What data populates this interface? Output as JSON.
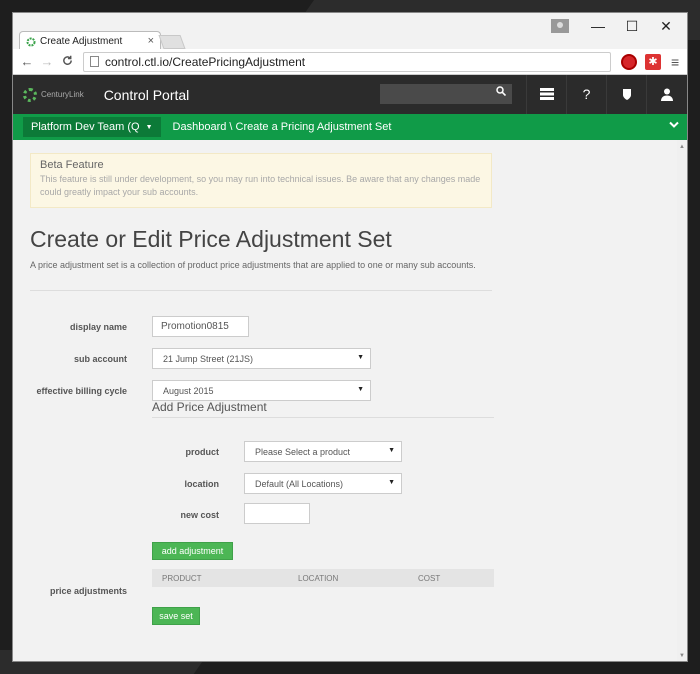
{
  "browser": {
    "tab_title": "Create Adjustment",
    "tab_close": "×",
    "url": "control.ctl.io/CreatePricingAdjustment",
    "window_controls": [
      "—",
      "☐",
      "✕"
    ],
    "nav": {
      "back": "←",
      "forward": "→",
      "reload": "C"
    },
    "menu": "≡"
  },
  "portal": {
    "logo_text": "CenturyLink",
    "title": "Control Portal",
    "search_placeholder": "",
    "header_icons": [
      "queue-icon",
      "help-icon",
      "shield-icon",
      "user-icon"
    ]
  },
  "greenbar": {
    "account": "Platform Dev Team (Q",
    "breadcrumb": "Dashboard \\ Create a Pricing Adjustment Set"
  },
  "beta": {
    "title": "Beta Feature",
    "text": "This feature is still under development, so you may run into technical issues. Be aware that any changes made could greatly impact your sub accounts."
  },
  "page": {
    "title": "Create or Edit Price Adjustment Set",
    "description": "A price adjustment set is a collection of product price adjustments that are applied to one or many sub accounts."
  },
  "form": {
    "display_name_label": "display name",
    "display_name_value": "Promotion0815",
    "sub_account_label": "sub account",
    "sub_account_value": "21 Jump Street (21JS)",
    "billing_cycle_label": "effective billing cycle",
    "billing_cycle_value": "August 2015"
  },
  "add_adjustment": {
    "title": "Add Price Adjustment",
    "product_label": "product",
    "product_value": "Please Select a product",
    "location_label": "location",
    "location_value": "Default (All Locations)",
    "new_cost_label": "new cost",
    "new_cost_value": "",
    "add_button": "add adjustment"
  },
  "price_adjustments": {
    "label": "price adjustments",
    "columns": [
      "PRODUCT",
      "LOCATION",
      "COST"
    ],
    "save_button": "save set"
  },
  "colors": {
    "green_bar": "#109b48",
    "button_green": "#4cb655",
    "header_dark": "#2b2b2b",
    "beta_bg": "#fcf7e4"
  }
}
